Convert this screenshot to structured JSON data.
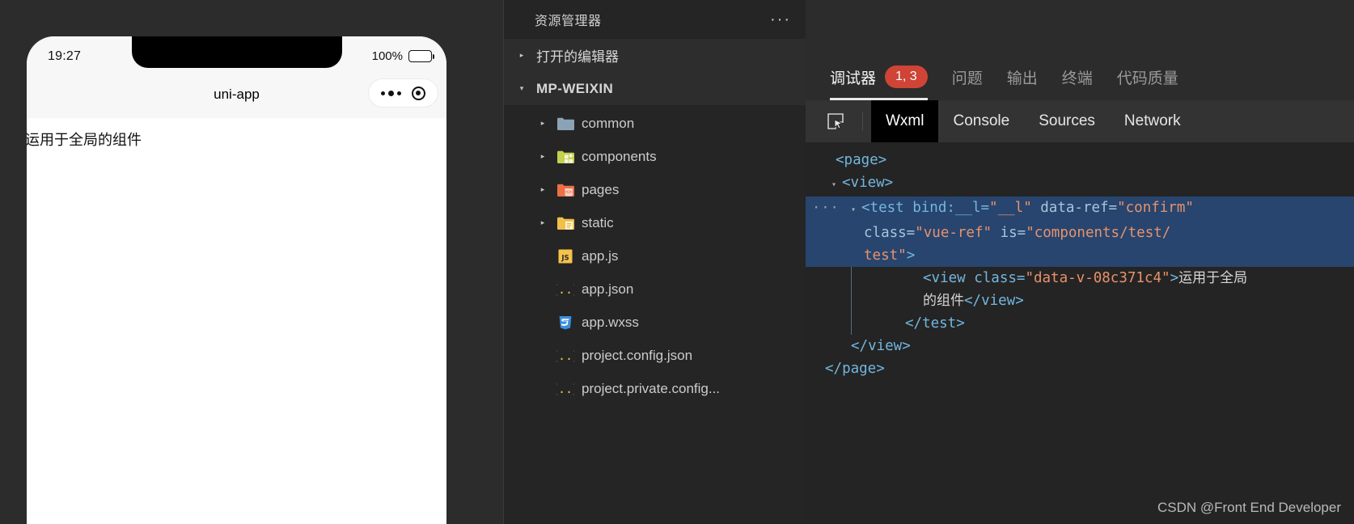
{
  "simulator": {
    "status_bar": {
      "time": "19:27",
      "battery_percent": "100%",
      "battery_icon": "battery-full-icon"
    },
    "nav_title": "uni-app",
    "capsule": {
      "more_icon": "more-dots-icon",
      "target_icon": "target-circle-icon"
    },
    "page_content": "运用于全局的组件"
  },
  "explorer": {
    "title": "资源管理器",
    "more_icon": "ellipsis-icon",
    "sections": [
      {
        "label": "打开的编辑器",
        "expanded": false,
        "twisty": "▸"
      },
      {
        "label": "MP-WEIXIN",
        "expanded": true,
        "twisty": "▾"
      }
    ],
    "tree": [
      {
        "name": "common",
        "type": "folder",
        "icon": "folder-blue-icon",
        "twisty": "▸",
        "color": "#8aa3b5"
      },
      {
        "name": "components",
        "type": "folder",
        "icon": "folder-components-icon",
        "twisty": "▸",
        "color": "#c5d14e"
      },
      {
        "name": "pages",
        "type": "folder",
        "icon": "folder-pages-icon",
        "twisty": "▸",
        "color": "#ec6f46"
      },
      {
        "name": "static",
        "type": "folder",
        "icon": "folder-static-icon",
        "twisty": "▸",
        "color": "#f0c04a"
      },
      {
        "name": "app.js",
        "type": "file",
        "icon": "js-file-icon",
        "twisty": "",
        "color": "#f5c24a"
      },
      {
        "name": "app.json",
        "type": "file",
        "icon": "json-file-icon",
        "twisty": "",
        "color": "#f5c24a"
      },
      {
        "name": "app.wxss",
        "type": "file",
        "icon": "css-file-icon",
        "twisty": "",
        "color": "#3b8fdd"
      },
      {
        "name": "project.config.json",
        "type": "file",
        "icon": "json-file-icon",
        "twisty": "",
        "color": "#f5c24a"
      },
      {
        "name": "project.private.config...",
        "type": "file",
        "icon": "json-file-icon",
        "twisty": "",
        "color": "#f5c24a"
      }
    ]
  },
  "devtools": {
    "panel_tabs": [
      {
        "label": "调试器",
        "badge": "1, 3",
        "active": true
      },
      {
        "label": "问题",
        "badge": "",
        "active": false
      },
      {
        "label": "输出",
        "badge": "",
        "active": false
      },
      {
        "label": "终端",
        "badge": "",
        "active": false
      },
      {
        "label": "代码质量",
        "badge": "",
        "active": false
      }
    ],
    "badge_color": "#cf4437",
    "inspect_icon": "inspect-element-icon",
    "sub_tabs": [
      {
        "label": "Wxml",
        "active": true
      },
      {
        "label": "Console",
        "active": false
      },
      {
        "label": "Sources",
        "active": false
      },
      {
        "label": "Network",
        "active": false
      }
    ],
    "code": {
      "line1": "<page>",
      "line2_tag": "<view>",
      "line3_a": "<test bind:__l=",
      "line3_b": "\"__l\"",
      "line3_c": " data-ref=",
      "line3_d": "\"confirm\"",
      "line4_a": "class=",
      "line4_b": "\"vue-ref\"",
      "line4_c": " is=",
      "line4_d": "\"components/test/",
      "line5_d": "test\"",
      "line5_gt": ">",
      "line6_a": "<view class=",
      "line6_b": "\"data-v-08c371c4\"",
      "line6_c": ">",
      "line6_text": "运用于全局",
      "line7_text": "的组件",
      "line7_close": "</view>",
      "line8": "</test>",
      "line9": "</view>",
      "line10": "</page>",
      "gutter_ellipsis": "···",
      "selection_color": "#27456f"
    },
    "watermark": "CSDN @Front End Developer"
  }
}
